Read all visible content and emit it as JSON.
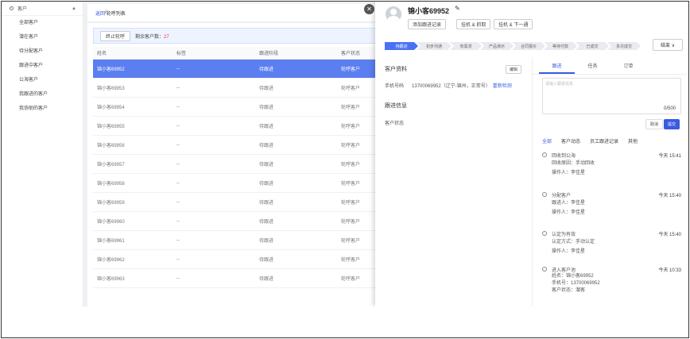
{
  "sidebar": {
    "header": "客户",
    "items": [
      "全部客户",
      "潜在客户",
      "待分配客户",
      "跟进中客户",
      "公海客户",
      "我跟进的客户",
      "我协助的客户"
    ]
  },
  "breadcrumb": {
    "back": "返回",
    "separator": " / ",
    "current": "轮呼列表"
  },
  "actions": {
    "stop_label": "终止轮呼",
    "remain_label": "剩余客户数：",
    "remain_count": "27"
  },
  "table": {
    "headers": [
      "姓名",
      "标签",
      "跟进阶段",
      "客户状态"
    ],
    "rows": [
      [
        "锦小客69952",
        "--",
        "待跟进",
        "轮呼客户"
      ],
      [
        "锦小客69953",
        "--",
        "待跟进",
        "轮呼客户"
      ],
      [
        "锦小客69954",
        "--",
        "待跟进",
        "轮呼客户"
      ],
      [
        "锦小客69955",
        "--",
        "待跟进",
        "轮呼客户"
      ],
      [
        "锦小客69956",
        "--",
        "待跟进",
        "轮呼客户"
      ],
      [
        "锦小客69957",
        "--",
        "待跟进",
        "轮呼客户"
      ],
      [
        "锦小客69958",
        "--",
        "待跟进",
        "轮呼客户"
      ],
      [
        "锦小客69959",
        "--",
        "待跟进",
        "轮呼客户"
      ],
      [
        "锦小客69960",
        "--",
        "待跟进",
        "轮呼客户"
      ],
      [
        "锦小客69961",
        "--",
        "待跟进",
        "轮呼客户"
      ],
      [
        "锦小客69962",
        "--",
        "待跟进",
        "轮呼客户"
      ],
      [
        "锦小客69963",
        "--",
        "待跟进",
        "轮呼客户"
      ]
    ]
  },
  "drawer": {
    "customer_name": "锦小客69952",
    "buttons": [
      "添加跟进记录",
      "挂机 & 抓取",
      "挂机 & 下一通"
    ],
    "stages": [
      "待跟进",
      "初步沟通",
      "有需求",
      "产品演示",
      "合同报价",
      "等待付款",
      "已成交",
      "多次成交"
    ],
    "end_label": "结束 ∨",
    "profile": {
      "title": "客户资料",
      "edit_label": "编辑",
      "phone_label": "手机号码",
      "phone_value": "13700069952（辽宁-锦州，正常号）",
      "recheck": "重新检测",
      "follow_title": "跟进信息",
      "status_label": "客户状态"
    },
    "tabs": [
      "跟进",
      "任务",
      "订单"
    ],
    "textarea_placeholder": "请输入跟进信息",
    "counter": "0/500",
    "cancel_label": "取消",
    "submit_label": "提交",
    "sub_tabs": [
      "全部",
      "客户动态",
      "员工跟进记录",
      "其他"
    ],
    "timeline": [
      {
        "title": "回收到公海",
        "time": "今天 15:41",
        "details": [
          "回收原因：手动回收",
          "操作人：李佳星"
        ]
      },
      {
        "title": "分配客户",
        "time": "今天 15:40",
        "details": [
          "跟进人：李佳星",
          "操作人：李佳星"
        ]
      },
      {
        "title": "认定为有效",
        "time": "今天 15:40",
        "details": [
          "认定方式：手动认定",
          "操作人：李佳星"
        ]
      },
      {
        "title": "进入客户池",
        "time": "今天 10:33",
        "details": [
          "姓名：锦小客69952",
          "手机号：13700069952",
          "客户状态：潜客"
        ]
      }
    ]
  }
}
